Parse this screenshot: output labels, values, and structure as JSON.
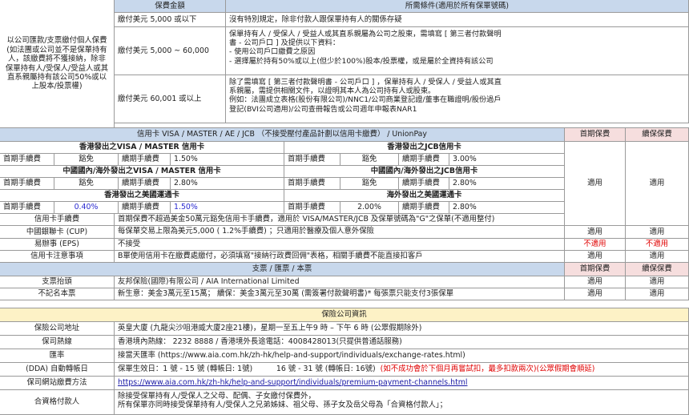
{
  "top": {
    "left_desc": "以公司匯款/支票繳付個人保費\n(如法團或公司並不是保單持有人，該繳費將不獲接納，除非保單持有人/受保人/受益人或其直系親屬持有該公司50%或以上股本/投票權)",
    "head_amount": "保費金額",
    "head_cond": "所需條件(適用於所有保單號碼)",
    "rows": [
      {
        "amount": "繳付美元 5,000 或以下",
        "lines": [
          "沒有特別規定，除非付款人跟保單持有人的關係存疑"
        ]
      },
      {
        "amount": "繳付美元 5,000 ~ 60,000",
        "lines": [
          "保單持有人 / 受保人 / 受益人或其直系親屬為公司之股東，需填寫 [ 第三者付款聲明",
          "書 - 公司戶口 ] 及提供以下資料：",
          "- 使用公司戶口繳費之原因",
          "- 選擇屬於持有50%或以上(但少於100%)股本/投票權，或是屬於全資持有該公司"
        ]
      },
      {
        "amount": "繳付美元 60,001 或以上",
        "lines": [
          "除了需填寫 [ 第三者付款聲明書 - 公司戶口 ] ，保單持有人 / 受保人 / 受益人或其直",
          "系親屬，需提供相關文件，以證明其本人為公司持有人或股東。",
          "例如：法團成立表格(股份有限公司)/NNC1/公司商業登記證/董事在職證明/股份過戶",
          "登記(BVI公司適用)/公司查冊報告或公司週年申報表NAR1"
        ]
      }
    ]
  },
  "cards": {
    "header": "信用卡 VISA / MASTER / AE / JCB （不接受壓付產品計劃以信用卡繳費） / UnionPay",
    "first_premium": "首期保費",
    "renewal_premium": "續保保費",
    "hk_visa_title": "香港發出之VISA / MASTER 信用卡",
    "hk_jcb_title": "香港發出之JCB信用卡",
    "cn_visa_title": "中國國內/海外發出之VISA / MASTER 信用卡",
    "cn_jcb_title": "中國國內/海外發出之JCB信用卡",
    "hk_ae_title": "香港發出之美國運通卡",
    "os_ae_title": "海外發出之美國運通卡",
    "first_fee": "首期手續費",
    "renewal_fee": "續期手續費",
    "waived": "豁免",
    "hk_visa_renewal": "1.50%",
    "hk_jcb_renewal": "3.00%",
    "cn_visa_renewal": "2.80%",
    "cn_jcb_renewal": "2.80%",
    "hk_ae_first": "0.40%",
    "hk_ae_renewal": "1.50%",
    "os_ae_first": "2.00%",
    "os_ae_renewal": "2.80%",
    "applicable": "適用"
  },
  "info_rows": [
    {
      "label": "信用卡手續費",
      "text": "首期保費不超過美金50萬元豁免信用卡手續費，適用於 VISA/MASTER/JCB 及保單號碼為\"G\"之保單(不適用整付)",
      "first": "",
      "renew": ""
    },
    {
      "label": "中國銀聯卡 (CUP)",
      "text": "每保單交易上限為美元5,000 ( 1.2%手續費) ；只適用於醫療及個人意外保險",
      "first": "適用",
      "renew": "適用"
    },
    {
      "label": "易辦事 (EPS)",
      "text": "不接受",
      "first": "不適用",
      "renew": "不適用"
    },
    {
      "label": "信用卡注意事項",
      "text": "B單使用信用卡在繳費處繳付，必須填寫\"接納行政費回佣\"表格，相關手續費不能直接扣客戶",
      "first": "適用",
      "renew": "適用"
    }
  ],
  "cheque": {
    "header": "支票 / 匯票 / 本票",
    "first_premium": "首期保費",
    "renewal_premium": "續保保費",
    "rows": [
      {
        "label": "支票抬頭",
        "text": "友邦保險(國際)有限公司 / AIA International Limited",
        "first": "適用",
        "renew": "適用"
      },
      {
        "label": "不記名本票",
        "text": "新生意：美金3萬元至15萬；  續保：美金3萬元至30萬 (需簽署付款聲明書)* 每張票只能支付3張保單",
        "first": "適用",
        "renew": "適用"
      }
    ]
  },
  "company": {
    "header": "保險公司資訊",
    "address_label": "保險公司地址",
    "address": "英皇大廈 (九龍尖沙咀港威大廈2座21樓)，星期一至五上午9 時 – 下午 6 時 (公眾假期除外)",
    "hotline_label": "保司熱線",
    "hotline": "香港境內熱線： 2232 8888  / 香港境外長途電話：4008428013(只提供普通話服務)",
    "rate_label": "匯率",
    "rate_prefix": "接當天匯率 (",
    "rate_url": "https://www.aia.com.hk/zh-hk/help-and-support/individuals/exchange-rates.html",
    "rate_suffix": ")",
    "dda_label": "(DDA) 自動轉帳日",
    "dda_text": "保單生效日：1 號 - 15 號 (轉帳日: 1號)          16 號 - 31 號 (轉帳日: 16號)",
    "dda_note": "(如不成功會於下個月再嘗試扣，最多扣款兩次)(公眾假期會順延)",
    "website_label": "保司網站繳費方法",
    "website_url": "https://www.aia.com.hk/zh-hk/help-and-support/individuals/premium-payment-channels.html",
    "payer_label": "合資格付款人",
    "payer_lines": [
      "除接受保單持有人/受保人之父母、配偶、子女繳付保費外，",
      "所有保單亦同時接受保單持有人/受保人之兄弟姊妹、祖父母、孫子女及岳父母為「合資格付款人」；"
    ]
  }
}
